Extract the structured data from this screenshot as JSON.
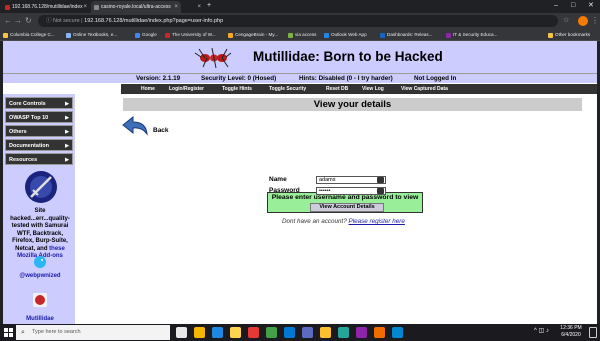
{
  "browser": {
    "tabs": [
      {
        "label": "192.168.76.128/mutillidae/index",
        "active": false
      },
      {
        "label": "casino-royale.local/ultra-access",
        "active": true
      },
      {
        "label": "",
        "active": false
      }
    ],
    "security_label": "Not secure",
    "url": "192.168.76.128/mutillidae/index.php?page=user-info.php",
    "bookmarks": [
      {
        "label": "Columbia College C...",
        "color": "#f4c542"
      },
      {
        "label": "Online Textbooks, e...",
        "color": "#8ab4f8"
      },
      {
        "label": "Google",
        "color": "#4285f4"
      },
      {
        "label": "The University of W...",
        "color": "#c62828"
      },
      {
        "label": "CengageBrain - My...",
        "color": "#f9a825"
      },
      {
        "label": "via access",
        "color": "#7cb342"
      },
      {
        "label": "Outlook Web App",
        "color": "#1e88e5"
      },
      {
        "label": "Dashboards: Releas...",
        "color": "#1565c0"
      },
      {
        "label": "IT & Security Educa...",
        "color": "#8e24aa"
      }
    ],
    "other_bookmarks": "Other bookmarks"
  },
  "app": {
    "title": "Mutillidae: Born to be Hacked",
    "version": "Version: 2.1.19",
    "security_level": "Security Level: 0 (Hosed)",
    "hints": "Hints: Disabled (0 - I try harder)",
    "login_status": "Not Logged In",
    "menu": [
      "Home",
      "Login/Register",
      "Toggle Hints",
      "Toggle Security",
      "Reset DB",
      "View Log",
      "View Captured Data"
    ]
  },
  "sidebar": {
    "items": [
      "Core Controls",
      "OWASP Top 10",
      "Others",
      "Documentation",
      "Resources"
    ],
    "blurb": "Site hacked...err...quality-tested with Samurai WTF, Backtrack, Firefox, Burp-Suite, Netcat, and",
    "blurb_link": "these Mozilla Add-ons",
    "twitter": "@webpwnized",
    "bottom_label": "Mutillidae"
  },
  "main": {
    "heading": "View your details",
    "back_label": "Back",
    "notice": "Please enter username and password to view account details",
    "name_label": "Name",
    "name_value": "adams",
    "password_label": "Password",
    "password_value": "••••••",
    "submit_label": "View Account Details",
    "register_prompt": "Dont have an account?",
    "register_link": "Please register here"
  },
  "taskbar": {
    "search_placeholder": "Type here to search",
    "time": "12:36 PM",
    "date": "6/4/2020",
    "apps": [
      "#e8e8e8",
      "#f4b400",
      "#1e88e5",
      "#ffd54f",
      "#e53935",
      "#43a047",
      "#0078d4",
      "#5c6bc0",
      "#fbc02d",
      "#26a69a",
      "#8e24aa",
      "#ef6c00",
      "#0288d1"
    ]
  }
}
